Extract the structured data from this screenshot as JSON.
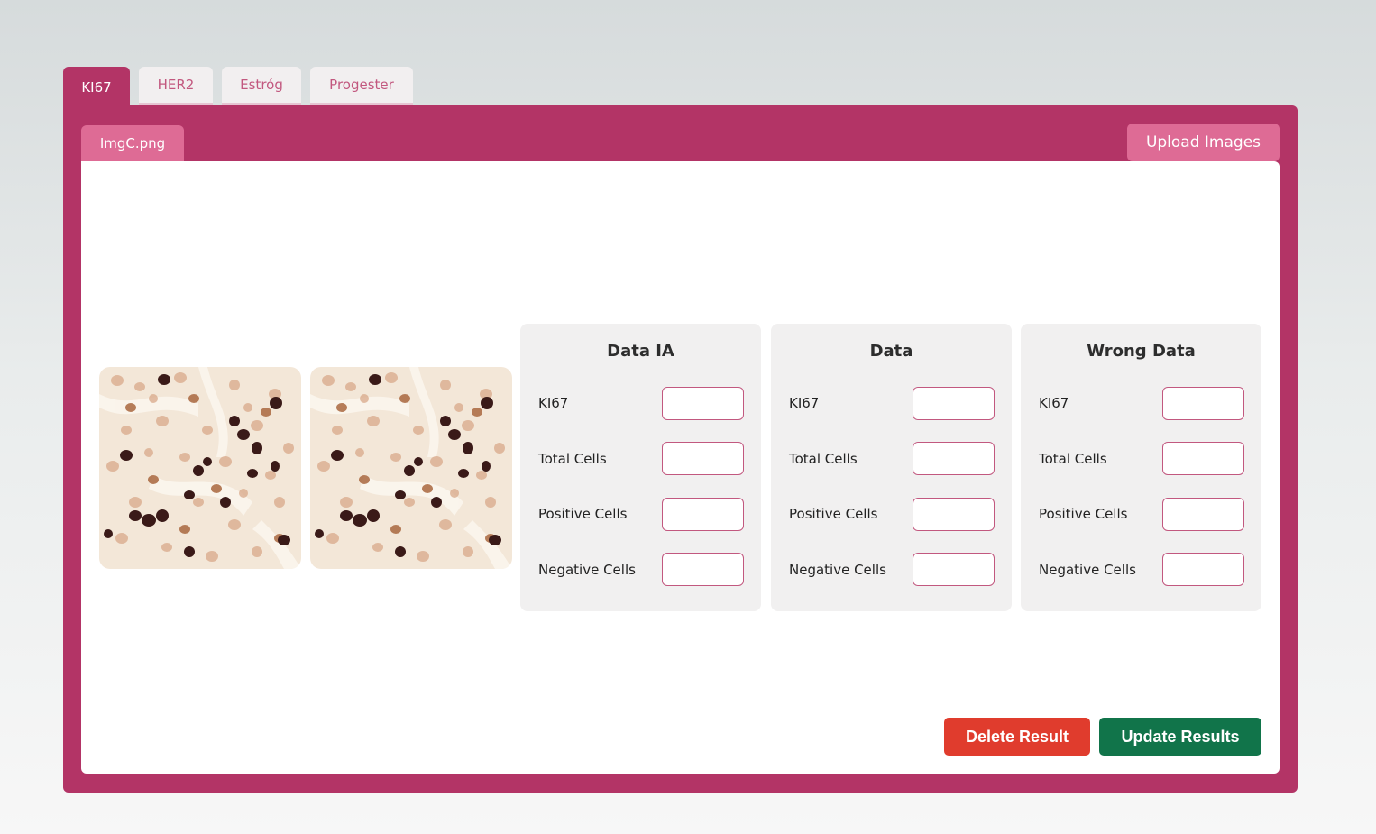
{
  "tabs": [
    {
      "label": "KI67",
      "active": true
    },
    {
      "label": "HER2",
      "active": false
    },
    {
      "label": "Estróg",
      "active": false
    },
    {
      "label": "Progester",
      "active": false
    }
  ],
  "file_tab": {
    "label": "ImgC.png"
  },
  "upload_button": {
    "label": "Upload Images"
  },
  "cards": [
    {
      "title": "Data IA",
      "rows": [
        {
          "label": "KI67",
          "value": ""
        },
        {
          "label": "Total Cells",
          "value": ""
        },
        {
          "label": "Positive Cells",
          "value": ""
        },
        {
          "label": "Negative Cells",
          "value": ""
        }
      ]
    },
    {
      "title": "Data",
      "rows": [
        {
          "label": "KI67",
          "value": ""
        },
        {
          "label": "Total Cells",
          "value": ""
        },
        {
          "label": "Positive Cells",
          "value": ""
        },
        {
          "label": "Negative Cells",
          "value": ""
        }
      ]
    },
    {
      "title": "Wrong Data",
      "rows": [
        {
          "label": "KI67",
          "value": ""
        },
        {
          "label": "Total Cells",
          "value": ""
        },
        {
          "label": "Positive Cells",
          "value": ""
        },
        {
          "label": "Negative Cells",
          "value": ""
        }
      ]
    }
  ],
  "actions": {
    "delete_label": "Delete Result",
    "update_label": "Update Results"
  },
  "colors": {
    "brand": "#b33466",
    "accent": "#de6b95",
    "delete": "#e03c2d",
    "update": "#11744a"
  }
}
